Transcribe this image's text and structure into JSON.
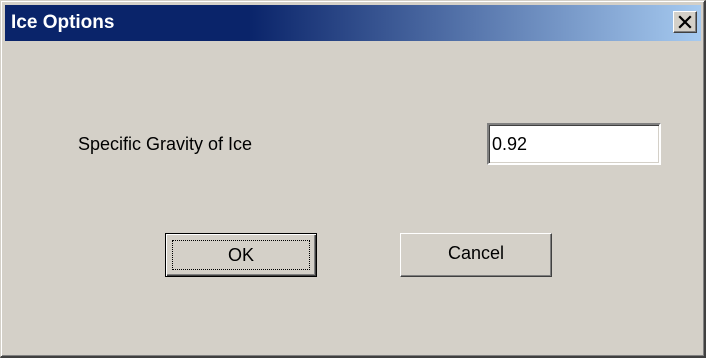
{
  "window": {
    "title": "Ice Options",
    "close_glyph": "close-icon"
  },
  "form": {
    "specific_gravity_label": "Specific Gravity of Ice",
    "specific_gravity_value": "0.92"
  },
  "buttons": {
    "ok_label": "OK",
    "cancel_label": "Cancel"
  },
  "colors": {
    "titlebar_start": "#0a246a",
    "titlebar_end": "#a6caf0",
    "face": "#d4d0c8"
  }
}
